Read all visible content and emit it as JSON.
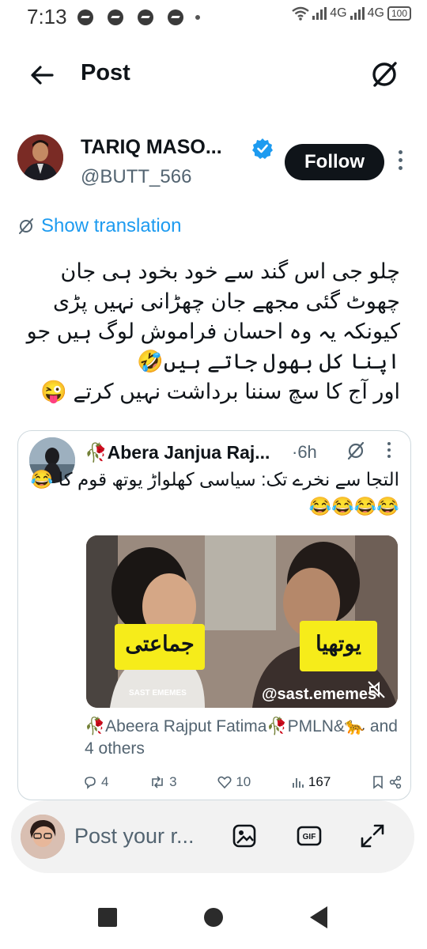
{
  "status_bar": {
    "time": "7:13",
    "network1": "4G",
    "network2": "4G",
    "battery": "100",
    "icons": [
      "messenger-icon",
      "messenger-icon",
      "messenger-icon",
      "messenger-icon",
      "wifi-icon",
      "signal-icon",
      "signal-icon",
      "battery-icon"
    ]
  },
  "header": {
    "title": "Post",
    "icons": [
      "back-arrow-icon",
      "grok-icon"
    ]
  },
  "post": {
    "author_name": "TARIQ MASO...",
    "author_handle": "@BUTT_566",
    "follow_label": "Follow",
    "show_translation": "Show translation",
    "body_lines": [
      "چلو جی اس گند سے خود بخود ہی جان",
      "چھوٹ گئی مجھے جان چھڑانی نہیں پڑی",
      "کیونکہ یہ وہ احسان فراموش لوگ ہیں جو",
      "اپنا کل بھول جاتے ہیں🤣",
      "اور آج کا سچ سننا برداشت نہیں کرتے 😜"
    ]
  },
  "quote": {
    "author_name": "🥀Abera Janjua Raj...",
    "time": "·6h",
    "text": "التجا سے نخرے تک: سیاسی کھلواڑ یوتھ قوم کا 😂😂😂😂😂",
    "media": {
      "label_left": "جماعتی",
      "label_right": "یوتھیا",
      "watermark": "@sast.ememes",
      "watermark_small": "SAST EMEMES"
    },
    "replying": "🥀Abeera Rajput Fatima🥀PMLN&🐆 and 4 others",
    "replies": "4",
    "reposts": "3",
    "likes": "10",
    "views": "167"
  },
  "compose": {
    "placeholder": "Post your r...",
    "icons": [
      "image-icon",
      "gif-icon",
      "expand-icon"
    ]
  },
  "nav": {
    "icons": [
      "recents-icon",
      "home-icon",
      "back-icon"
    ]
  },
  "colors": {
    "accent": "#1d9bf0",
    "text": "#0f1419",
    "secondary": "#536471",
    "follow_bg": "#0f1419",
    "label_yellow": "#f6ec1a"
  }
}
